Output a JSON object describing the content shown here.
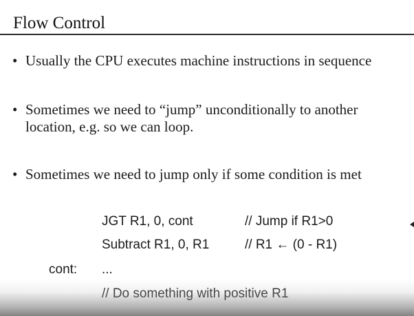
{
  "slide": {
    "title": "Flow Control",
    "bullets": [
      {
        "marker": "•",
        "text": "Usually the CPU executes machine instructions in sequence"
      },
      {
        "marker": "•",
        "line1": "Sometimes we need to “jump” unconditionally to another",
        "line2": "location, e.g. so we can loop."
      },
      {
        "marker": "•",
        "text": "Sometimes we need to jump only if some condition is met"
      }
    ],
    "code": {
      "line1": {
        "instruction": "JGT R1, 0, cont",
        "comment": "// Jump if R1>0"
      },
      "line2": {
        "instruction": "Subtract R1, 0, R1",
        "comment": "// R1 ← (0 - R1)"
      },
      "line3": {
        "label": "cont:",
        "instruction": "..."
      },
      "line4": {
        "comment": "// Do something with positive R1"
      }
    }
  }
}
